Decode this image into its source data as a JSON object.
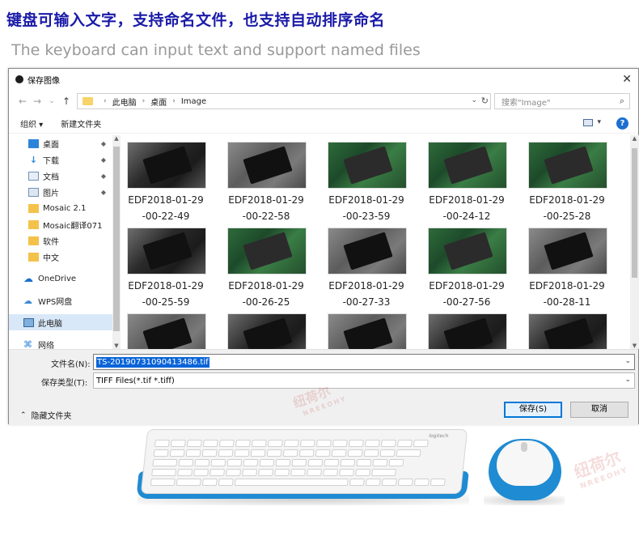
{
  "heading": {
    "chinese": "键盘可输入文字，支持命名文件，也支持自动排序命名",
    "english": "The keyboard can input text and support named files"
  },
  "dialog": {
    "title": "保存图像",
    "close_glyph": "✕",
    "address": {
      "back_glyph": "←",
      "forward_glyph": "→",
      "recent_glyph": "⌄",
      "up_glyph": "↑",
      "breadcrumbs": [
        "此电脑",
        "桌面",
        "Image"
      ],
      "separator_glyph": "›",
      "dropdown_glyph": "⌄",
      "refresh_glyph": "↻",
      "search_placeholder": "搜索\"Image\"",
      "search_glyph": "⌕"
    },
    "toolbar": {
      "organize": "组织 ▾",
      "new_folder": "新建文件夹",
      "view_caret": "▾",
      "help": "?"
    },
    "nav": {
      "items": [
        {
          "label": "桌面",
          "icon": "desktop-icon",
          "pinned": true
        },
        {
          "label": "下载",
          "icon": "download-icon",
          "pinned": true
        },
        {
          "label": "文档",
          "icon": "document-icon",
          "pinned": true
        },
        {
          "label": "图片",
          "icon": "pictures-icon",
          "pinned": true
        },
        {
          "label": "Mosaic 2.1",
          "icon": "folder-icon",
          "pinned": false
        },
        {
          "label": "Mosaic翻译071",
          "icon": "folder-icon",
          "pinned": false
        },
        {
          "label": "软件",
          "icon": "folder-icon",
          "pinned": false
        },
        {
          "label": "中文",
          "icon": "folder-icon",
          "pinned": false
        },
        {
          "label": "OneDrive",
          "icon": "onedrive-icon",
          "pinned": false
        },
        {
          "label": "WPS网盘",
          "icon": "wps-cloud-icon",
          "pinned": false
        },
        {
          "label": "此电脑",
          "icon": "this-pc-icon",
          "pinned": false
        },
        {
          "label": "网络",
          "icon": "network-icon",
          "pinned": false
        }
      ],
      "pin_glyph": "📌",
      "scroll_up": "▲",
      "scroll_down": "▼"
    },
    "files": [
      {
        "line1": "EDF2018-01-29",
        "line2": "-00-22-49",
        "style": "dark"
      },
      {
        "line1": "EDF2018-01-29",
        "line2": "-00-22-58",
        "style": "grey"
      },
      {
        "line1": "EDF2018-01-29",
        "line2": "-00-23-59",
        "style": "green"
      },
      {
        "line1": "EDF2018-01-29",
        "line2": "-00-24-12",
        "style": "green"
      },
      {
        "line1": "EDF2018-01-29",
        "line2": "-00-25-28",
        "style": "green"
      },
      {
        "line1": "EDF2018-01-29",
        "line2": "-00-25-59",
        "style": "dark"
      },
      {
        "line1": "EDF2018-01-29",
        "line2": "-00-26-25",
        "style": "green"
      },
      {
        "line1": "EDF2018-01-29",
        "line2": "-00-27-33",
        "style": "grey"
      },
      {
        "line1": "EDF2018-01-29",
        "line2": "-00-27-56",
        "style": "green"
      },
      {
        "line1": "EDF2018-01-29",
        "line2": "-00-28-11",
        "style": "grey"
      },
      {
        "line1": "",
        "line2": "",
        "style": "grey"
      },
      {
        "line1": "",
        "line2": "",
        "style": "dark"
      },
      {
        "line1": "",
        "line2": "",
        "style": "grey"
      },
      {
        "line1": "",
        "line2": "",
        "style": "dark"
      },
      {
        "line1": "",
        "line2": "",
        "style": "dark"
      }
    ],
    "filename_label": "文件名(N):",
    "filename_value": "TS-20190731090413486.tif",
    "filetype_label": "保存类型(T):",
    "filetype_value": "TIFF Files(*.tif *.tiff)",
    "hide_folders": "隐藏文件夹",
    "save_button": "保存(S)",
    "cancel_button": "取消",
    "dropdown_glyph": "⌄",
    "hide_caret": "⌃"
  },
  "watermark": {
    "text_cn": "纽荷尔",
    "text_en": "NREEOHY",
    "color": "#c83c3c"
  },
  "product": {
    "brand": "logitech"
  },
  "colors": {
    "heading": "#1a1aa8",
    "accent_blue": "#1f8bd2",
    "selection": "#0a64d8"
  }
}
